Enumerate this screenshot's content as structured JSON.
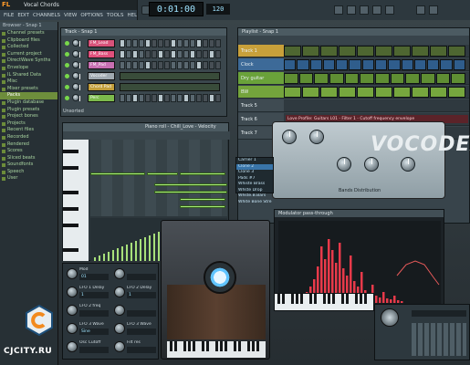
{
  "app": {
    "logo_text": "FL STUDIO",
    "project_title": "Vocal Chords"
  },
  "menu": [
    "FILE",
    "EDIT",
    "CHANNELS",
    "VIEW",
    "OPTIONS",
    "TOOLS",
    "HELP"
  ],
  "transport": {
    "time": "0:01:00",
    "tempo": "120"
  },
  "browser": {
    "header": "Browser - Snap 1",
    "items": [
      "Channel presets",
      "Clipboard files",
      "Collected",
      "Current project",
      "DirectWave Synths",
      "Envelope",
      "IL Shared Data",
      "Misc",
      "Mixer presets",
      "Packs",
      "Plugin database",
      "Plugin presets",
      "Project bones",
      "Projects",
      "Recent files",
      "Recorded",
      "Rendered",
      "Scores",
      "Sliced beats",
      "Soundfonts",
      "Speech",
      "User"
    ],
    "selected_index": 9
  },
  "step_sequencer": {
    "title": "Track - Snap 1",
    "channels": [
      {
        "name": "FM_Lead",
        "color": "#d8527a"
      },
      {
        "name": "FM_Bass",
        "color": "#e0507c"
      },
      {
        "name": "FM_Pad",
        "color": "#c86fb2"
      },
      {
        "name": "Vocoder",
        "color": "#a0a9b0"
      },
      {
        "name": "Chord Pad",
        "color": "#c39f3b"
      },
      {
        "name": "Perc",
        "color": "#7cba4c"
      }
    ],
    "footer": "Unsorted"
  },
  "playlist": {
    "title": "Playlist - Snap 1",
    "tracks": [
      {
        "name": "Track 1",
        "color": "#c8a03a"
      },
      {
        "name": "Clock",
        "color": "#3d6a98"
      },
      {
        "name": "Dry guitar",
        "color": "#6aa23a"
      },
      {
        "name": "BW",
        "color": "#74a43c"
      },
      {
        "name": "Track 5",
        "color": "#8b3a3a"
      },
      {
        "name": "Track 6",
        "color": "#44525a"
      },
      {
        "name": "Track 7",
        "color": "#44525a"
      }
    ],
    "automation_label": "Love Profile: Guitars L01 - Filter 1 - Cutoff frequency envelope"
  },
  "piano_roll": {
    "title": "Piano roll - Chill_Love - Velocity"
  },
  "vocoder": {
    "name": "VOCODEX",
    "presets": [
      "Carrier 1",
      "Clone 2",
      "Clone 3",
      "Pads #7",
      "Whiste Brass",
      "Whste Drop",
      "Whste.B.Bars",
      "White Bone Stre"
    ],
    "selected_preset_index": 1,
    "bottom_label": "Bands  Distribution"
  },
  "spectrum": {
    "title": "Modulator pass-through"
  },
  "lfo": [
    {
      "label": "Mod",
      "value": "01"
    },
    {
      "label": "",
      "value": ""
    },
    {
      "label": "LFO 1 Delay",
      "value": "1"
    },
    {
      "label": "LFO 2 Delay",
      "value": "1"
    },
    {
      "label": "LFO 2 freq",
      "value": ""
    },
    {
      "label": "",
      "value": ""
    },
    {
      "label": "LFO 3 Wave",
      "value": "Sine"
    },
    {
      "label": "LFO 3 Wave",
      "value": ""
    },
    {
      "label": "Osc Cutoff",
      "value": ""
    },
    {
      "label": "Filt res",
      "value": ""
    }
  ],
  "watermark": "CJCITY.RU",
  "colors": {
    "accent_green": "#a8ee78",
    "accent_blue": "#60c4ff",
    "spectrum_red": "#e83a4a"
  }
}
